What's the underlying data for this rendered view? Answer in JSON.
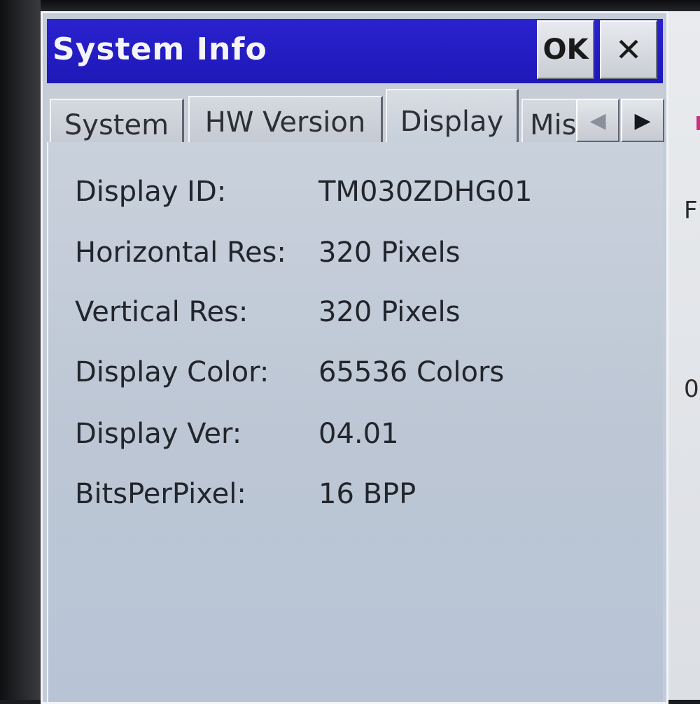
{
  "window": {
    "title": "System Info",
    "ok_label": "OK",
    "close_symbol": "✕"
  },
  "tabs": [
    {
      "label": "System",
      "selected": false
    },
    {
      "label": "HW Version",
      "selected": false
    },
    {
      "label": "Display",
      "selected": true
    },
    {
      "label": "Misc",
      "selected": false
    }
  ],
  "tab_scroll": {
    "left_icon": "◀",
    "right_icon": "▶"
  },
  "display_info": [
    {
      "label": "Display ID:",
      "value": "TM030ZDHG01"
    },
    {
      "label": "Horizontal Res:",
      "value": "320 Pixels"
    },
    {
      "label": "Vertical Res:",
      "value": "320 Pixels"
    },
    {
      "label": "Display Color:",
      "value": "65536 Colors"
    },
    {
      "label": "Display Ver:",
      "value": "04.01"
    },
    {
      "label": "BitsPerPixel:",
      "value": "16 BPP"
    }
  ],
  "background_window": {
    "visible_letter": "F",
    "visible_glyph": "0"
  },
  "colors": {
    "titlebar": "#1e18b8",
    "panel": "#c3ccd8",
    "title_text": "#f5f5f8"
  }
}
